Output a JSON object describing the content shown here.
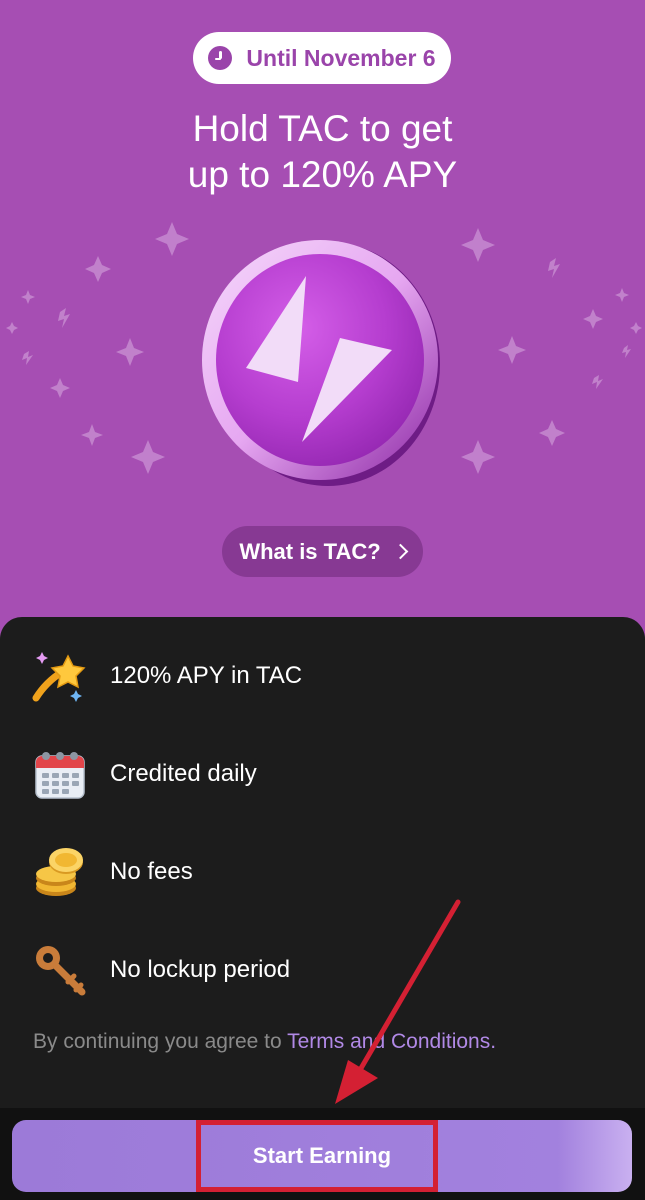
{
  "promo": {
    "deadline": "Until November 6",
    "headline_line1": "Hold TAC to get",
    "headline_line2": "up to 120% APY",
    "what_is_label": "What is TAC?"
  },
  "features": [
    {
      "icon": "shooting-star-icon",
      "label": "120% APY in TAC"
    },
    {
      "icon": "calendar-icon",
      "label": "Credited daily"
    },
    {
      "icon": "coins-icon",
      "label": "No fees"
    },
    {
      "icon": "key-icon",
      "label": "No lockup period"
    }
  ],
  "terms": {
    "prefix": "By continuing you agree to ",
    "link": "Terms and Conditions",
    "suffix": "."
  },
  "cta": {
    "label": "Start Earning"
  },
  "colors": {
    "hero_bg": "#a64eb3",
    "accent": "#9a44aa",
    "sheet_bg": "#1c1c1c",
    "cta": "#a281de",
    "link": "#b189e6",
    "annotation": "#d42033"
  }
}
